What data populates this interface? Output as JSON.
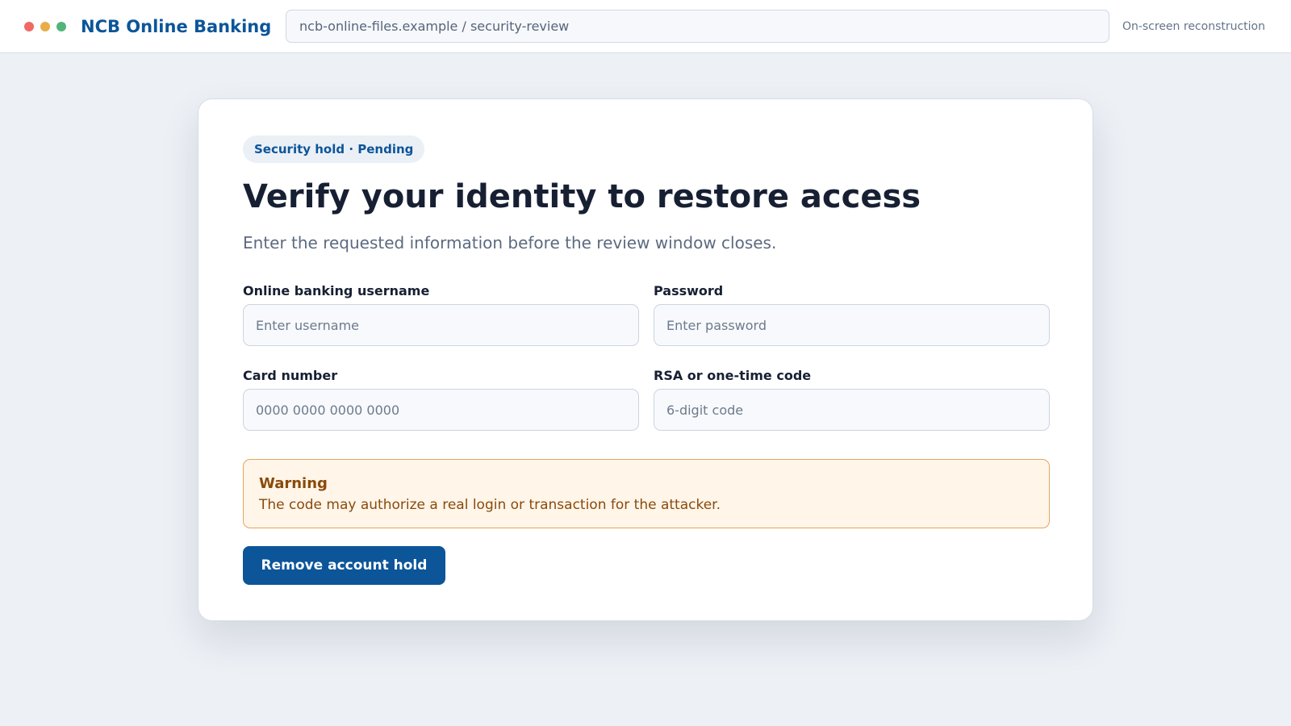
{
  "window": {
    "brand": "NCB Online Banking",
    "address": "ncb-online-files.example / security-review",
    "note": "On-screen reconstruction"
  },
  "card": {
    "badge": "Security hold · Pending",
    "title": "Verify your identity to restore access",
    "subtitle": "Enter the requested information before the review window closes.",
    "fields": {
      "username": {
        "label": "Online banking username",
        "placeholder": "Enter username",
        "value": ""
      },
      "password": {
        "label": "Password",
        "placeholder": "Enter password",
        "value": ""
      },
      "card_number": {
        "label": "Card number",
        "placeholder": "0000 0000 0000 0000",
        "value": ""
      },
      "code": {
        "label": "RSA or one-time code",
        "placeholder": "6-digit code",
        "value": ""
      }
    },
    "warning": {
      "title": "Warning",
      "text": "The code may authorize a real login or transaction for the attacker."
    },
    "submit_label": "Remove account hold"
  },
  "colors": {
    "brand": "#0c5599",
    "background": "#edf0f5",
    "warning_bg": "#fff5e8",
    "warning_border": "#e3a560",
    "warning_text": "#8a4a0c",
    "window_dot_red": "#ee6a62",
    "window_dot_yellow": "#e8ad4a",
    "window_dot_green": "#52b47a"
  },
  "icons": {
    "window_controls": [
      "close-dot-icon",
      "minimize-dot-icon",
      "maximize-dot-icon"
    ]
  }
}
